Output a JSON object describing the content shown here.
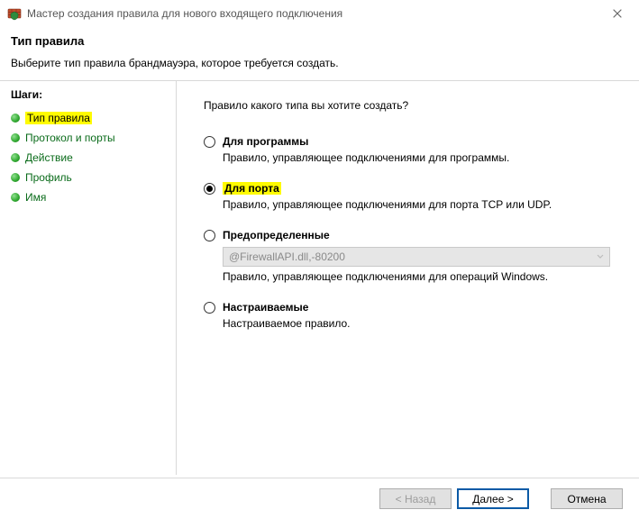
{
  "window": {
    "title": "Мастер создания правила для нового входящего подключения"
  },
  "header": {
    "title": "Тип правила",
    "subtitle": "Выберите тип правила брандмауэра, которое требуется создать."
  },
  "sidebar": {
    "steps_label": "Шаги:",
    "items": [
      {
        "label": "Тип правила",
        "active": true
      },
      {
        "label": "Протокол и порты",
        "active": false
      },
      {
        "label": "Действие",
        "active": false
      },
      {
        "label": "Профиль",
        "active": false
      },
      {
        "label": "Имя",
        "active": false
      }
    ]
  },
  "content": {
    "question": "Правило какого типа вы хотите создать?",
    "options": {
      "program": {
        "label": "Для программы",
        "desc": "Правило, управляющее подключениями для программы."
      },
      "port": {
        "label": "Для порта",
        "desc": "Правило, управляющее подключениями для порта TCP или UDP."
      },
      "predefined": {
        "label": "Предопределенные",
        "select_value": "@FirewallAPI.dll,-80200",
        "desc": "Правило, управляющее подключениями для операций Windows."
      },
      "custom": {
        "label": "Настраиваемые",
        "desc": "Настраиваемое правило."
      }
    }
  },
  "footer": {
    "back": "< Назад",
    "next": "Далее >",
    "cancel": "Отмена"
  }
}
